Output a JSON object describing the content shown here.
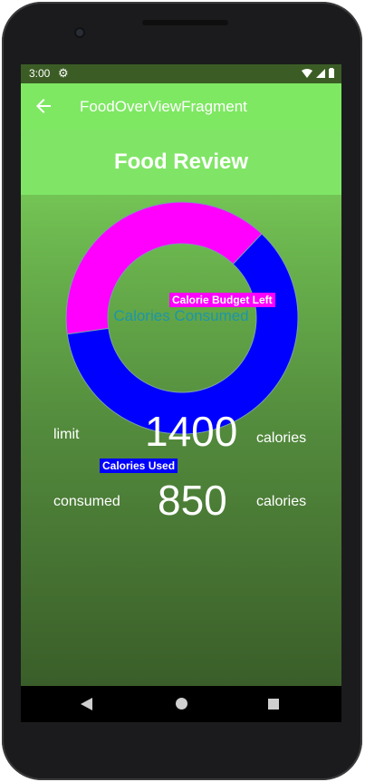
{
  "status": {
    "time": "3:00"
  },
  "appbar": {
    "title": "FoodOverViewFragment"
  },
  "page": {
    "title": "Food Review"
  },
  "chart_data": {
    "type": "pie",
    "categories": [
      "Calorie Budget Left",
      "Calories Used"
    ],
    "values": [
      550,
      850
    ],
    "center_text": "Calories Consumed",
    "colors": [
      "#ff00ff",
      "#0000ff"
    ]
  },
  "stats": {
    "limit": {
      "label": "limit",
      "value": "1400",
      "unit": "calories"
    },
    "consumed": {
      "label": "consumed",
      "value": "850",
      "unit": "calories"
    }
  },
  "icons": {
    "back": "arrow-left-icon",
    "settings": "gear-icon",
    "wifi": "wifi-icon",
    "signal": "signal-icon",
    "battery": "battery-icon"
  }
}
